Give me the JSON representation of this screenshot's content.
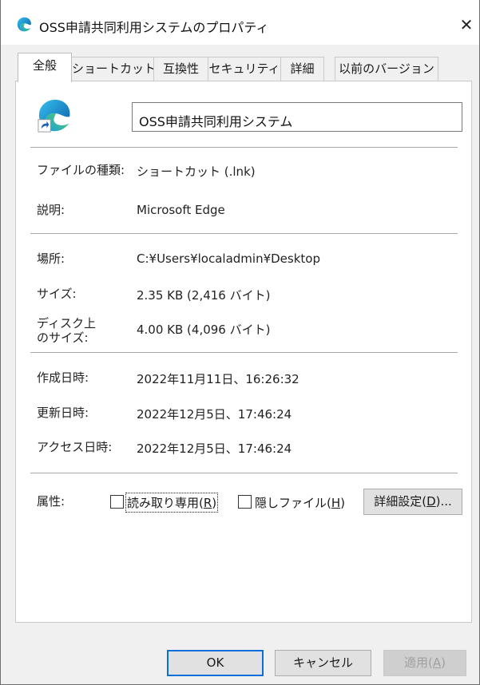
{
  "window": {
    "title": "OSS申請共同利用システムのプロパティ",
    "close_glyph": "✕"
  },
  "tabs": [
    {
      "label": "全般",
      "active": true
    },
    {
      "label": "ショートカット",
      "active": false
    },
    {
      "label": "互換性",
      "active": false
    },
    {
      "label": "セキュリティ",
      "active": false
    },
    {
      "label": "詳細",
      "active": false
    },
    {
      "label": "以前のバージョン",
      "active": false
    }
  ],
  "general": {
    "icon": "microsoft-edge-shortcut-icon",
    "name_value": "OSS申請共同利用システム",
    "filetype": {
      "label": "ファイルの種類:",
      "value": "ショートカット (.lnk)"
    },
    "description": {
      "label": "説明:",
      "value": "Microsoft Edge"
    },
    "location": {
      "label": "場所:",
      "value": "C:¥Users¥localadmin¥Desktop"
    },
    "size": {
      "label": "サイズ:",
      "value": "2.35 KB (2,416 バイト)"
    },
    "size_on_disk": {
      "label_line1": "ディスク上",
      "label_line2": "のサイズ:",
      "value": "4.00 KB (4,096 バイト)"
    },
    "created": {
      "label": "作成日時:",
      "value": "2022年11月11日、16:26:32"
    },
    "modified": {
      "label": "更新日時:",
      "value": "2022年12月5日、17:46:24"
    },
    "accessed": {
      "label": "アクセス日時:",
      "value": "2022年12月5日、17:46:24"
    },
    "attributes": {
      "label": "属性:",
      "readonly": {
        "text": "読み取り専用(",
        "key": "R",
        "close": ")",
        "checked": false
      },
      "hidden": {
        "text": "隠しファイル(",
        "key": "H",
        "close": ")",
        "checked": false
      },
      "advanced": {
        "text": "詳細設定(",
        "key": "D",
        "close": ")..."
      }
    }
  },
  "footer": {
    "ok": "OK",
    "cancel": "キャンセル",
    "apply": {
      "text": "適用(",
      "key": "A",
      "close": ")",
      "enabled": false
    }
  },
  "colors": {
    "accent": "#0a6fd8",
    "dialog_bg": "#f0f0f0",
    "page_bg": "#ffffff"
  }
}
